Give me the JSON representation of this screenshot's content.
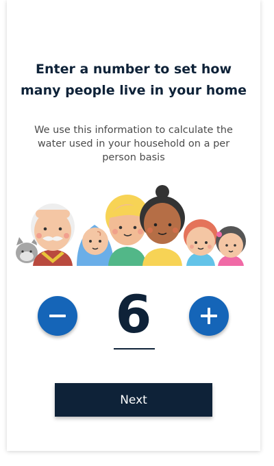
{
  "prompt": {
    "title_line1": "Enter a number to set how",
    "title_line2": "many people live in your home",
    "subtitle_line1": "We use this information to calculate the",
    "subtitle_line2": "water used in your household on a per",
    "subtitle_line3": "person basis"
  },
  "stepper": {
    "value": "6",
    "decrement_icon": "minus-icon",
    "increment_icon": "plus-icon"
  },
  "actions": {
    "next_label": "Next"
  },
  "illustration": {
    "name": "household-people-illustration"
  },
  "colors": {
    "navy": "#0e2238",
    "blue": "#1565b8",
    "text_gray": "#4a4a4a"
  }
}
